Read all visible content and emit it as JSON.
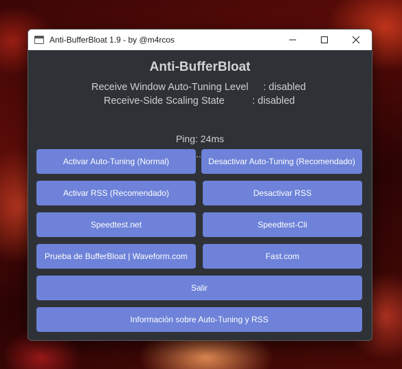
{
  "window": {
    "title": "Anti-BufferBloat 1.9 - by @m4rcos",
    "controls": [
      "minimize",
      "maximize",
      "close"
    ]
  },
  "header": {
    "title": "Anti-BufferBloat"
  },
  "status": {
    "auto_tuning_label": "Receive Window Auto-Tuning Level",
    "auto_tuning_value": ": disabled",
    "rss_label": "Receive-Side Scaling State",
    "rss_value": ": disabled",
    "ping": "Ping: 24ms",
    "progress": "..."
  },
  "buttons": {
    "activate_auto_tuning": "Activar Auto-Tuning (Normal)",
    "deactivate_auto_tuning": "Desactivar Auto-Tuning (Recomendado)",
    "activate_rss": "Activar RSS (Recomendado)",
    "deactivate_rss": "Desactivar RSS",
    "speedtest_net": "Speedtest.net",
    "speedtest_cli": "Speedtest-Cli",
    "bufferbloat_test": "Prueba de BufferBloat | Waveform.com",
    "fast_com": "Fast.com",
    "exit": "Salir",
    "info": "Información sobre Auto-Tuning y RSS"
  },
  "colors": {
    "window_bg": "#2e3136",
    "button_bg": "#6d82d8",
    "text": "#d0d0d0",
    "titlebar_bg": "#ffffff"
  }
}
